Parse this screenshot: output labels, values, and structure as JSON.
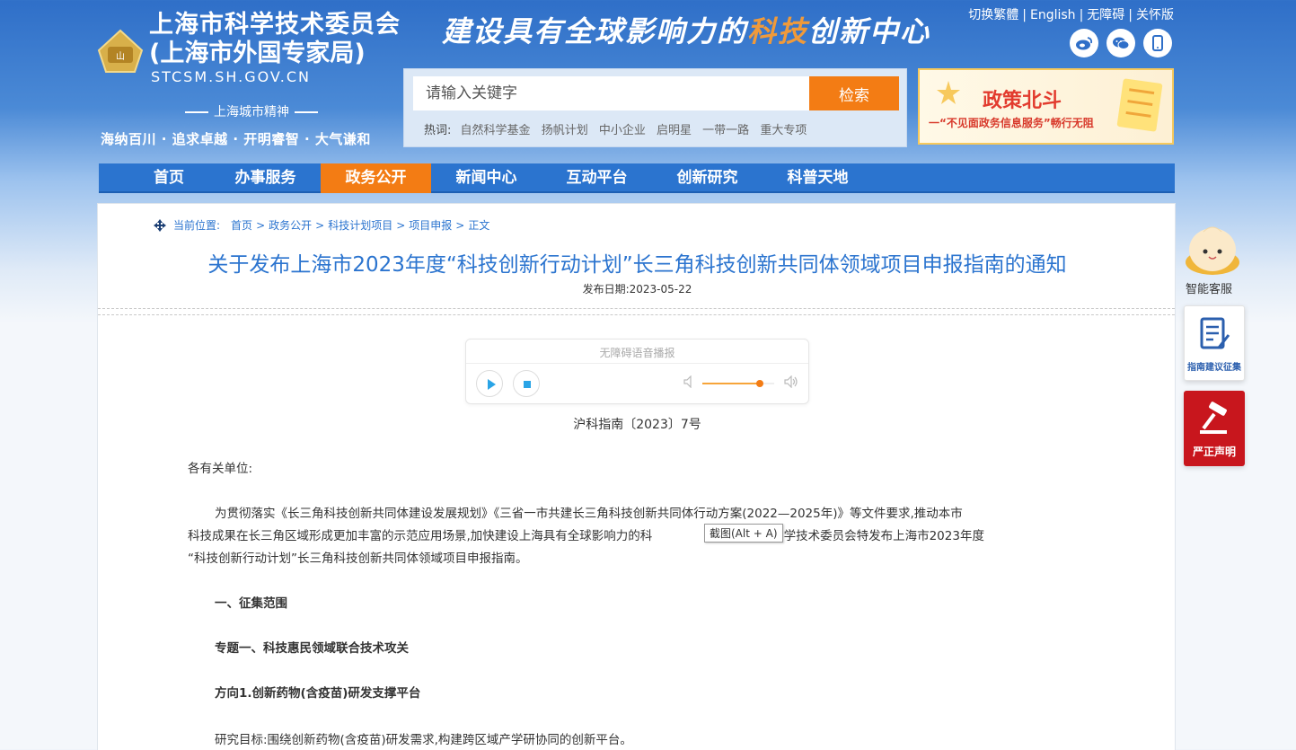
{
  "header": {
    "site_name_line1": "上海市科学技术委员会",
    "site_name_line2": "(上海市外国专家局)",
    "domain": "STCSM.SH.GOV.CN",
    "spirit_title": "上海城市精神",
    "spirit_text": "海纳百川 · 追求卓越 · 开明睿智 · 大气谦和",
    "slogan_a": "建设具有全球影响力的",
    "slogan_b": "科技",
    "slogan_c": "创新中心",
    "top_links": [
      "切换繁體",
      "English",
      "无障碍",
      "关怀版"
    ],
    "social_icons": [
      "weibo-icon",
      "wechat-icon",
      "mobile-icon"
    ]
  },
  "search": {
    "placeholder": "请输入关键字",
    "button": "检索",
    "hot_label": "热词:",
    "hot_words": [
      "自然科学基金",
      "扬帆计划",
      "中小企业",
      "启明星",
      "一带一路",
      "重大专项"
    ]
  },
  "ad": {
    "title": "政策北斗",
    "subtitle": "一“不见面政务信息服务”畅行无阻"
  },
  "nav": [
    "首页",
    "办事服务",
    "政务公开",
    "新闻中心",
    "互动平台",
    "创新研究",
    "科普天地"
  ],
  "nav_active_index": 2,
  "breadcrumb": {
    "label": "当前位置:",
    "items": [
      "首页",
      "政务公开",
      "科技计划项目",
      "项目申报",
      "正文"
    ]
  },
  "article": {
    "title": "关于发布上海市2023年度“科技创新行动计划”长三角科技创新共同体领域项目申报指南的通知",
    "pubdate": "发布日期:2023-05-22",
    "docno": "沪科指南〔2023〕7号",
    "salutation": "各有关单位:",
    "para1_a": "为贯彻落实《长三角科技创新共同体建设发展规划》《三省一市共建长三角科技创新共同体行动方案(2022—2025年)》等文件要求,推动本市",
    "para1_b": "科技成果在长三角区域形成更加丰富的示范应用场景,加快建设上海具有全球影响力的科",
    "para1_b2": ",上海市科学技术委员会特发布上海市2023年度",
    "para1_c": "“科技创新行动计划”长三角科技创新共同体领域项目申报指南。",
    "section1": "一、征集范围",
    "topic1": "专题一、科技惠民领域联合技术攻关",
    "direction1": "方向1.创新药物(含疫苗)研发支撑平台",
    "goal": "研究目标:围绕创新药物(含疫苗)研发需求,构建跨区域产学研协同的创新平台。"
  },
  "player": {
    "title": "无障碍语音播报",
    "volume": 0.8
  },
  "tooltip": "截图(Alt + A)",
  "side": {
    "bot_label": "智能客服",
    "card1_label": "指南建议征集",
    "card2_label": "严正声明"
  },
  "colors": {
    "primary_blue": "#2b74cf",
    "accent_orange": "#f37c14"
  }
}
